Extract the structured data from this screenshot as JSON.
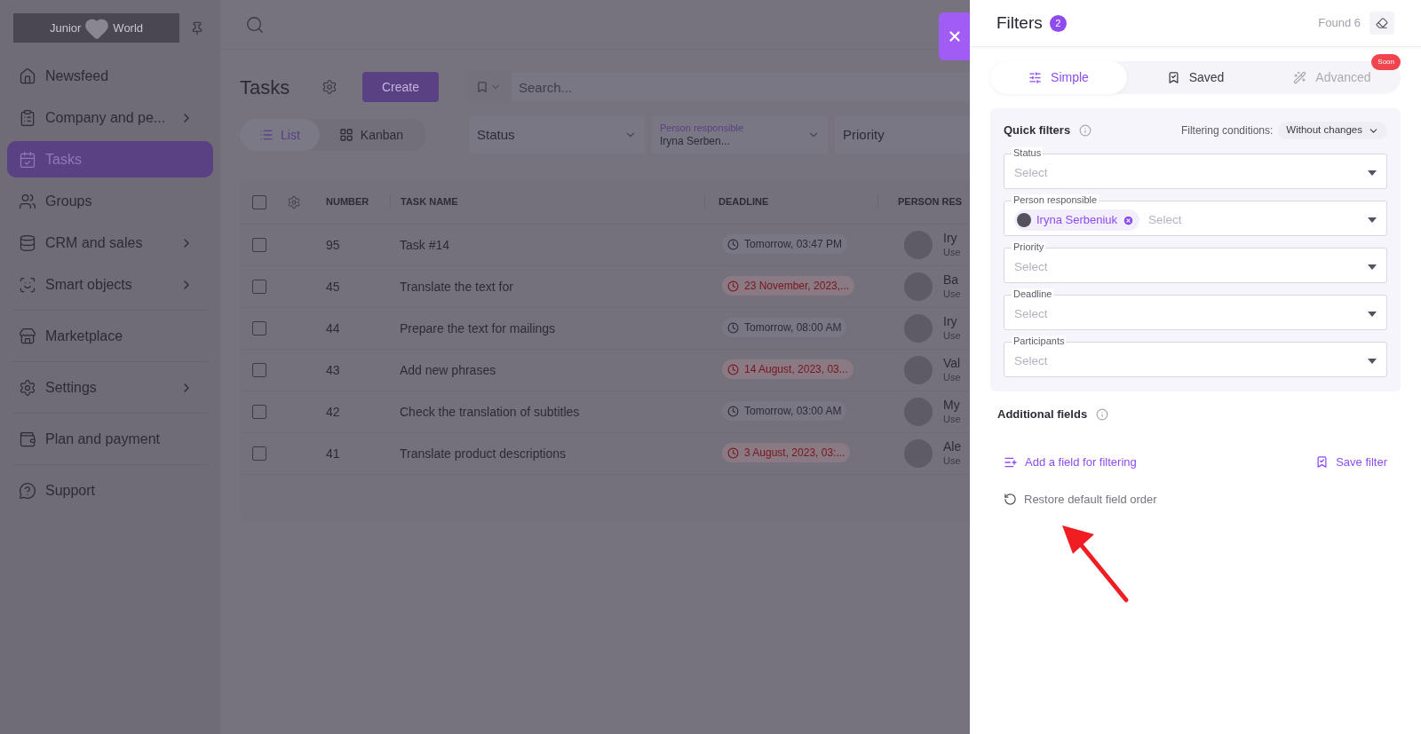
{
  "sidebar": {
    "logo": {
      "left": "Junior",
      "right": "World"
    },
    "groups": [
      {
        "items": [
          {
            "label": "Newsfeed",
            "selected": false,
            "expandable": false
          },
          {
            "label": "Company and pe...",
            "selected": false,
            "expandable": true
          },
          {
            "label": "Tasks",
            "selected": true,
            "expandable": false
          },
          {
            "label": "Groups",
            "selected": false,
            "expandable": false
          },
          {
            "label": "CRM and sales",
            "selected": false,
            "expandable": true
          },
          {
            "label": "Smart objects",
            "selected": false,
            "expandable": true
          }
        ]
      },
      {
        "items": [
          {
            "label": "Marketplace",
            "selected": false,
            "expandable": false
          }
        ]
      },
      {
        "items": [
          {
            "label": "Settings",
            "selected": false,
            "expandable": true
          }
        ]
      },
      {
        "items": [
          {
            "label": "Plan and payment",
            "selected": false,
            "expandable": false
          }
        ]
      },
      {
        "items": [
          {
            "label": "Support",
            "selected": false,
            "expandable": false
          }
        ]
      }
    ]
  },
  "page": {
    "title": "Tasks",
    "create_button": "Create",
    "search": {
      "placeholder": "Search..."
    },
    "views": [
      {
        "label": "List",
        "selected": true
      },
      {
        "label": "Kanban",
        "selected": false
      }
    ],
    "filters": [
      {
        "label": "Status"
      },
      {
        "label": "Person responsible",
        "value": "Iryna Serben..."
      },
      {
        "label": "Priority"
      }
    ]
  },
  "table": {
    "select_all_checked": false,
    "columns": [
      "NUMBER",
      "TASK NAME",
      "DEADLINE",
      "PERSON RES"
    ],
    "rows": [
      {
        "number": "95",
        "name": "Task #14",
        "deadline": "Tomorrow, 03:47 PM",
        "overdue": false,
        "person": "Iry",
        "role": "Use",
        "checked": false
      },
      {
        "number": "45",
        "name": "Translate the text for",
        "deadline": "23 November, 2023,...",
        "overdue": true,
        "person": "Ba",
        "role": "Use",
        "checked": false
      },
      {
        "number": "44",
        "name": "Prepare the text for mailings",
        "deadline": "Tomorrow, 08:00 AM",
        "overdue": false,
        "person": "Iry",
        "role": "Use",
        "checked": false
      },
      {
        "number": "43",
        "name": "Add new phrases",
        "deadline": "14 August, 2023, 03...",
        "overdue": true,
        "person": "Val",
        "role": "Use",
        "checked": false
      },
      {
        "number": "42",
        "name": "Check the translation of subtitles",
        "deadline": "Tomorrow, 03:00 AM",
        "overdue": false,
        "person": "My",
        "role": "Use",
        "checked": false
      },
      {
        "number": "41",
        "name": "Translate product descriptions",
        "deadline": "3 August, 2023, 03:...",
        "overdue": true,
        "person": "Ale",
        "role": "Use",
        "checked": false
      }
    ]
  },
  "filter_panel": {
    "title": "Filters",
    "count": "2",
    "found": "Found 6",
    "tabs": [
      {
        "label": "Simple",
        "selected": true,
        "disabled": false
      },
      {
        "label": "Saved",
        "selected": false,
        "disabled": false
      },
      {
        "label": "Advanced",
        "selected": false,
        "disabled": true,
        "badge": "Soon"
      }
    ],
    "quick_filters": {
      "title": "Quick filters",
      "conditions_label": "Filtering conditions:",
      "conditions_value": "Without changes",
      "fields": [
        {
          "label": "Status",
          "placeholder": "Select"
        },
        {
          "label": "Person responsible",
          "placeholder": "Select",
          "chips": [
            "Iryna Serbeniuk"
          ]
        },
        {
          "label": "Priority",
          "placeholder": "Select"
        },
        {
          "label": "Deadline",
          "placeholder": "Select"
        },
        {
          "label": "Participants",
          "placeholder": "Select"
        }
      ]
    },
    "additional_fields": "Additional fields",
    "add_field": "Add a field for filtering",
    "save_filter": "Save filter",
    "restore": "Restore default field order"
  }
}
